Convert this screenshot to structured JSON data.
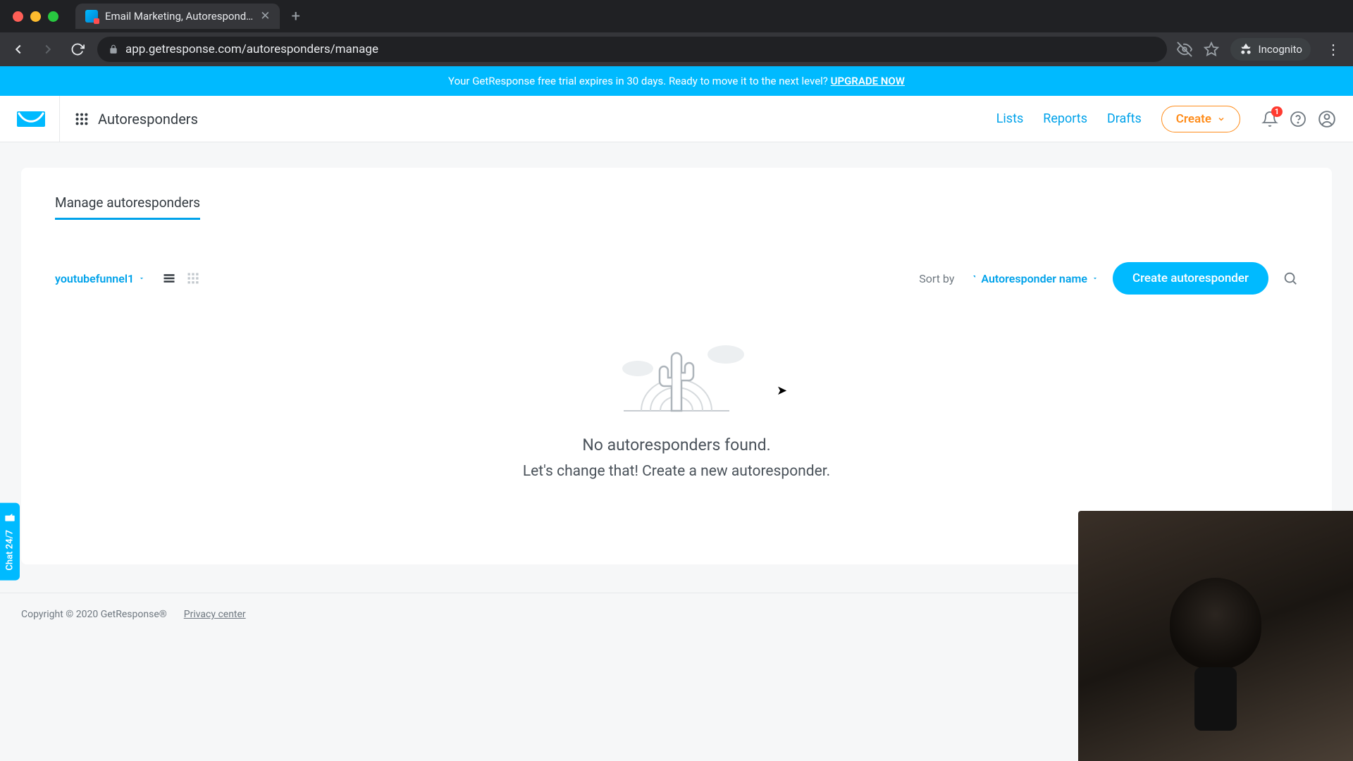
{
  "browser": {
    "tab_title": "Email Marketing, Autorespond…",
    "url": "app.getresponse.com/autoresponders/manage",
    "incognito_label": "Incognito"
  },
  "banner": {
    "text_before": "Your GetResponse free trial expires in 30 days. Ready to move it to the next level? ",
    "cta": "UPGRADE NOW"
  },
  "topbar": {
    "page_name": "Autoresponders",
    "nav": {
      "lists": "Lists",
      "reports": "Reports",
      "drafts": "Drafts",
      "create": "Create"
    },
    "notification_count": "1"
  },
  "content": {
    "tab_manage": "Manage autoresponders",
    "list_name": "youtubefunnel1",
    "sort_label": "Sort by",
    "sort_value": "Autoresponder name",
    "create_button": "Create autoresponder",
    "empty_title": "No autoresponders found.",
    "empty_sub": "Let's change that! Create a new autoresponder."
  },
  "footer": {
    "copyright": "Copyright © 2020 GetResponse®",
    "privacy": "Privacy center"
  },
  "chat_label": "Chat 24/7"
}
